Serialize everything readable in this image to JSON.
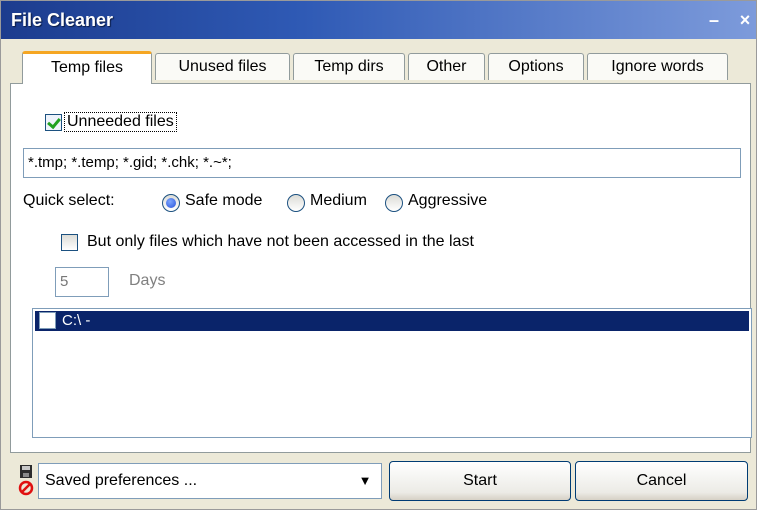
{
  "window": {
    "title": "File Cleaner",
    "minimize_glyph": "–",
    "close_glyph": "×"
  },
  "tabs": [
    {
      "label": "Temp files",
      "active": true
    },
    {
      "label": "Unused files",
      "active": false
    },
    {
      "label": "Temp dirs",
      "active": false
    },
    {
      "label": "Other",
      "active": false
    },
    {
      "label": "Options",
      "active": false
    },
    {
      "label": "Ignore words",
      "active": false
    }
  ],
  "panel": {
    "unneeded_label": "Unneeded files",
    "unneeded_checked": true,
    "patterns_value": "*.tmp; *.temp; *.gid; *.chk; *.~*;",
    "quick_select_label": "Quick select:",
    "quick_options": [
      {
        "label": "Safe mode",
        "selected": true
      },
      {
        "label": "Medium",
        "selected": false
      },
      {
        "label": "Aggressive",
        "selected": false
      }
    ],
    "access_label": "But only files which have not been accessed in the last",
    "access_checked": false,
    "days_value": "5",
    "days_label": "Days",
    "drive_list": [
      {
        "label": "C:\\  -",
        "checked": false,
        "selected": true
      }
    ]
  },
  "bottom": {
    "preferences_value": "Saved preferences ...",
    "start_label": "Start",
    "cancel_label": "Cancel"
  },
  "colors": {
    "titlebar": "#2f5ab5",
    "selection": "#0a246a",
    "active_tab_accent": "#f5a623"
  }
}
